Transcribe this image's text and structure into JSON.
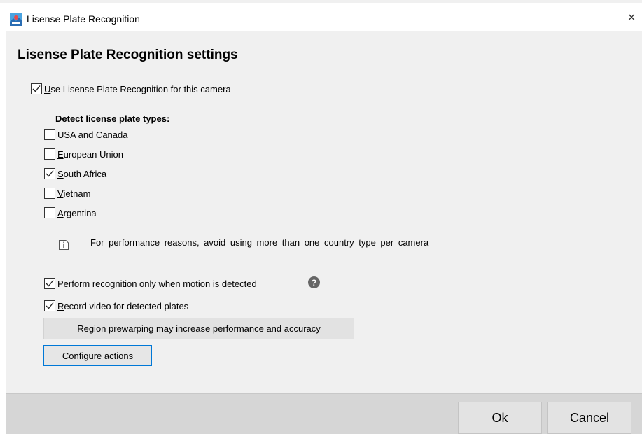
{
  "window": {
    "title": "Lisense Plate Recognition",
    "close_glyph": "×",
    "app_icon": "app-icon"
  },
  "dialog": {
    "heading": "Lisense Plate Recognition settings",
    "use_lpr": {
      "label": "Use Lisense Plate Recognition for this camera",
      "accel": "U",
      "rest": "se Lisense Plate Recognition for this camera",
      "checked": true
    },
    "detect_types_label": "Detect license plate types:",
    "plate_types": [
      {
        "pre": "USA ",
        "accel": "a",
        "post": "nd Canada",
        "checked": false
      },
      {
        "pre": "",
        "accel": "E",
        "post": "uropean Union",
        "checked": false
      },
      {
        "pre": "",
        "accel": "S",
        "post": "outh Africa",
        "checked": true
      },
      {
        "pre": "",
        "accel": "V",
        "post": "ietnam",
        "checked": false
      },
      {
        "pre": "",
        "accel": "A",
        "post": "rgentina",
        "checked": false
      }
    ],
    "info_note": "For performance reasons, avoid using more than one country type per camera",
    "motion_only": {
      "accel": "P",
      "rest": "erform recognition only when motion is detected",
      "checked": true
    },
    "help_glyph": "?",
    "record_video": {
      "accel": "R",
      "rest": "ecord video for detected plates",
      "checked": true
    },
    "prewarp_button": "Region prewarping may increase performance and accuracy",
    "configure_button": {
      "pre": "Co",
      "accel": "n",
      "post": "figure actions"
    }
  },
  "footer": {
    "ok": {
      "accel": "O",
      "rest": "k"
    },
    "cancel": {
      "accel": "C",
      "rest": "ancel"
    }
  },
  "colors": {
    "accent": "#0078d7",
    "panel": "#f0f0f0",
    "footer": "#d6d6d6"
  }
}
